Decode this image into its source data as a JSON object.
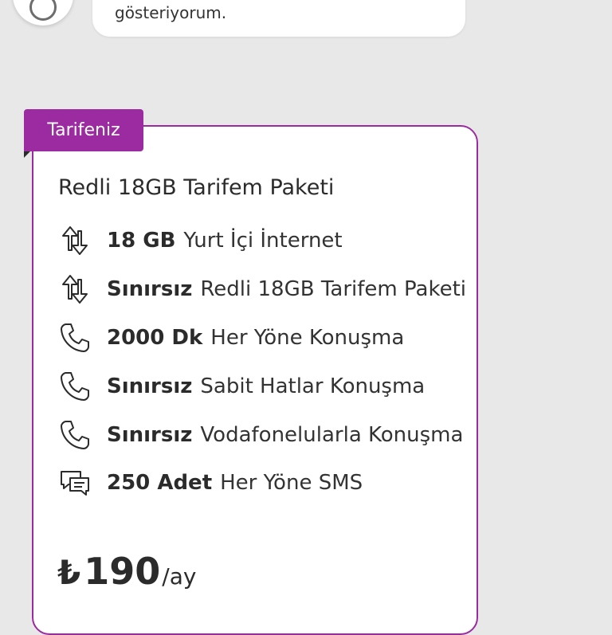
{
  "chat": {
    "bubble_text": "gösteriyorum."
  },
  "card": {
    "tag_label": "Tarifeniz",
    "title": "Redli 18GB Tarifem Paketi",
    "features": [
      {
        "icon": "data-arrows-icon",
        "amount": "18 GB",
        "label": "Yurt İçi İnternet"
      },
      {
        "icon": "data-arrows-icon",
        "amount": "Sınırsız",
        "label": "Redli 18GB Tarifem Paketi"
      },
      {
        "icon": "phone-icon",
        "amount": "2000 Dk",
        "label": "Her Yöne Konuşma"
      },
      {
        "icon": "phone-icon",
        "amount": "Sınırsız",
        "label": "Sabit Hatlar Konuşma"
      },
      {
        "icon": "phone-icon",
        "amount": "Sınırsız",
        "label": "Vodafonelularla Konuşma"
      },
      {
        "icon": "chat-bubbles-icon",
        "amount": "250 Adet",
        "label": "Her Yöne SMS"
      }
    ],
    "price": {
      "currency": "₺",
      "amount": "190",
      "period": "/ay"
    }
  },
  "colors": {
    "brand_purple": "#9c2aa0",
    "background": "#e9e8e9",
    "text": "#2b2b2b"
  }
}
